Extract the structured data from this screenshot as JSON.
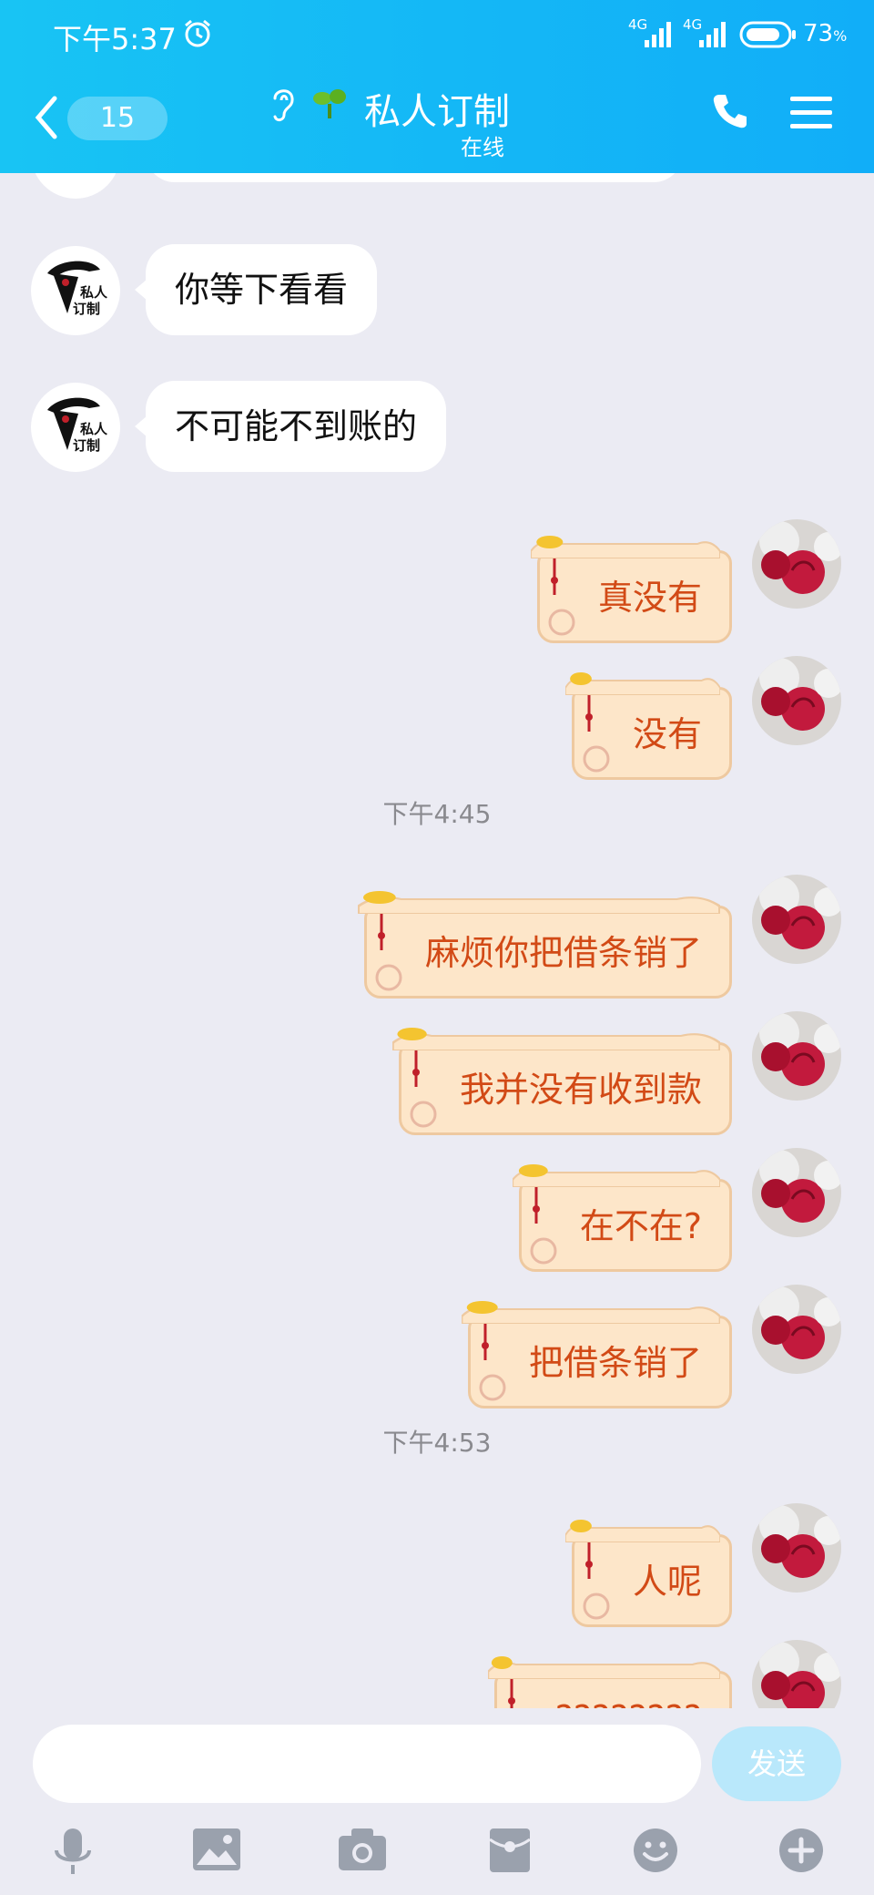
{
  "status_bar": {
    "time": "下午5:37",
    "network_1": "4G",
    "network_2": "4G",
    "battery_percent": "73",
    "battery_unit": "%"
  },
  "header": {
    "unread_count": "15",
    "contact_name": "私人订制",
    "contact_status": "在线"
  },
  "messages": [
    {
      "side": "in",
      "text": "你等下看看"
    },
    {
      "side": "in",
      "text": "不可能不到账的"
    },
    {
      "side": "out",
      "text": "真没有"
    },
    {
      "side": "out",
      "text": "没有"
    },
    {
      "timestamp": "下午4:45"
    },
    {
      "side": "out",
      "text": "麻烦你把借条销了"
    },
    {
      "side": "out",
      "text": "我并没有收到款"
    },
    {
      "side": "out",
      "text": "在不在?"
    },
    {
      "side": "out",
      "text": "把借条销了"
    },
    {
      "timestamp": "下午4:53"
    },
    {
      "side": "out",
      "text": "人呢"
    },
    {
      "side": "out",
      "text": "????????"
    }
  ],
  "input": {
    "placeholder": "",
    "send_label": "发送"
  },
  "toolbar": [
    "microphone-icon",
    "image-icon",
    "camera-icon",
    "red-packet-icon",
    "emoji-icon",
    "plus-icon"
  ],
  "colors": {
    "header": "#14b7f6",
    "chat_bg": "#ebebf3",
    "out_text": "#d24a16",
    "out_bubble": "#fde6c9",
    "send_button": "#b9e8fb"
  }
}
